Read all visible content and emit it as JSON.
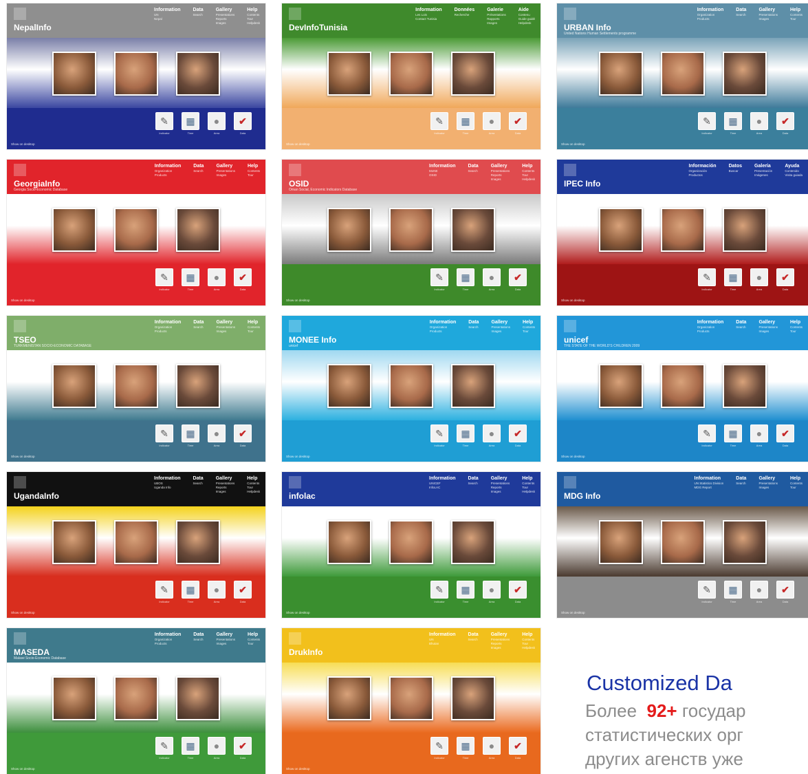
{
  "caption": {
    "title": "Customized Da",
    "line1_before": "Более",
    "line1_highlight": "92+",
    "line1_after": "государ",
    "line2": "статистических орг",
    "line3": "других агенств уже"
  },
  "footer_icon_labels": [
    "Indicator",
    "Time",
    "Area",
    "Data"
  ],
  "show_on_desktop": "Show on desktop",
  "tiles": [
    {
      "id": "nepal",
      "title": "NepalInfo",
      "subtitle": "",
      "header_color": "#8f8f8f",
      "band_top": "#7a7fa8",
      "band_bottom": "#3a46a0",
      "foot_color": "#1f2c8f",
      "menu": [
        {
          "head": "Information",
          "subs": [
            "UN",
            "Nepal"
          ]
        },
        {
          "head": "Data",
          "subs": [
            "Search"
          ]
        },
        {
          "head": "Gallery",
          "subs": [
            "Presentations",
            "Reports",
            "Images"
          ]
        },
        {
          "head": "Help",
          "subs": [
            "Contents",
            "Tour",
            "Helpdesk"
          ]
        }
      ]
    },
    {
      "id": "tunisia",
      "title": "DevInfoTunisia",
      "subtitle": "",
      "header_color": "#3f8a2c",
      "band_top": "#4a9a35",
      "band_bottom": "#f0a85a",
      "foot_color": "#f2b070",
      "menu": [
        {
          "head": "Information",
          "subs": [
            "Les Lois",
            "Contact Tunisia"
          ]
        },
        {
          "head": "Données",
          "subs": [
            "Recherche"
          ]
        },
        {
          "head": "Galerie",
          "subs": [
            "Présentations",
            "Rapports",
            "Images"
          ]
        },
        {
          "head": "Aide",
          "subs": [
            "Contenu",
            "Guide guidé",
            "Helpdesk"
          ]
        }
      ]
    },
    {
      "id": "urban",
      "title": "URBAN Info",
      "subtitle": "United Nations Human Settlements programme",
      "header_color": "#5e8fa8",
      "band_top": "#7aa3b8",
      "band_bottom": "#3e7a9a",
      "foot_color": "#3b7f9c",
      "menu": [
        {
          "head": "Information",
          "subs": [
            "Organization",
            "Products"
          ]
        },
        {
          "head": "Data",
          "subs": [
            "Search"
          ]
        },
        {
          "head": "Gallery",
          "subs": [
            "Presentations",
            "Images"
          ]
        },
        {
          "head": "Help",
          "subs": [
            "Contents",
            "Tour"
          ]
        }
      ]
    },
    {
      "id": "georgia",
      "title": "GeorgiaInfo",
      "subtitle": "Georgia Socio-Economic Database",
      "header_color": "#e1242b",
      "band_top": "#ffffff",
      "band_bottom": "#e1242b",
      "foot_color": "#e1242b",
      "menu": [
        {
          "head": "Information",
          "subs": [
            "Organization",
            "Products"
          ]
        },
        {
          "head": "Data",
          "subs": [
            "Search"
          ]
        },
        {
          "head": "Gallery",
          "subs": [
            "Presentations",
            "Images"
          ]
        },
        {
          "head": "Help",
          "subs": [
            "Contents",
            "Tour"
          ]
        }
      ]
    },
    {
      "id": "osid",
      "title": "OSID",
      "subtitle": "Oman Social, Economic Indicators Database",
      "header_color": "#e04b4e",
      "band_top": "#c9c9c9",
      "band_bottom": "#7a7a7a",
      "foot_color": "#3e8a2a",
      "menu": [
        {
          "head": "Information",
          "subs": [
            "MoNE",
            "OSID"
          ]
        },
        {
          "head": "Data",
          "subs": [
            "Search"
          ]
        },
        {
          "head": "Gallery",
          "subs": [
            "Presentations",
            "Reports",
            "Images"
          ]
        },
        {
          "head": "Help",
          "subs": [
            "Contents",
            "Tour",
            "Helpdesk"
          ]
        }
      ]
    },
    {
      "id": "ipec",
      "title": "IPEC Info",
      "subtitle": "",
      "header_color": "#1f3a9a",
      "band_top": "#ffffff",
      "band_bottom": "#b01c1c",
      "foot_color": "#9e1414",
      "menu": [
        {
          "head": "Información",
          "subs": [
            "Organización",
            "Productos"
          ]
        },
        {
          "head": "Datos",
          "subs": [
            "Buscar"
          ]
        },
        {
          "head": "Galería",
          "subs": [
            "Presentación",
            "Imágenes"
          ]
        },
        {
          "head": "Ayuda",
          "subs": [
            "Contenido",
            "Visita guiada"
          ]
        }
      ]
    },
    {
      "id": "tseo",
      "title": "TSEO",
      "subtitle": "TURKMENISTAN SOCIO-ECONOMIC DATABASE",
      "header_color": "#7fae6a",
      "band_top": "#ffffff",
      "band_bottom": "#3f7a8f",
      "foot_color": "#3f728c",
      "menu": [
        {
          "head": "Information",
          "subs": [
            "Organization",
            "Products"
          ]
        },
        {
          "head": "Data",
          "subs": [
            "Search"
          ]
        },
        {
          "head": "Gallery",
          "subs": [
            "Presentations",
            "Images"
          ]
        },
        {
          "head": "Help",
          "subs": [
            "Contents",
            "Tour"
          ]
        }
      ]
    },
    {
      "id": "monee",
      "title": "MONEE Info",
      "subtitle": "unicef",
      "header_color": "#1fa8dc",
      "band_top": "#9fd8f0",
      "band_bottom": "#2cb0e0",
      "foot_color": "#1f9ed4",
      "menu": [
        {
          "head": "Information",
          "subs": [
            "Organization",
            "Products"
          ]
        },
        {
          "head": "Data",
          "subs": [
            "Search"
          ]
        },
        {
          "head": "Gallery",
          "subs": [
            "Presentations",
            "Images"
          ]
        },
        {
          "head": "Help",
          "subs": [
            "Contents",
            "Tour"
          ]
        }
      ]
    },
    {
      "id": "unicef",
      "title": "unicef",
      "subtitle": "THE STATE OF THE WORLD'S CHILDREN 2009",
      "header_color": "#2296d8",
      "band_top": "#ffffff",
      "band_bottom": "#1f8fd0",
      "foot_color": "#1d86c8",
      "menu": [
        {
          "head": "Information",
          "subs": [
            "Organization",
            "Products"
          ]
        },
        {
          "head": "Data",
          "subs": [
            "Search"
          ]
        },
        {
          "head": "Gallery",
          "subs": [
            "Presentations",
            "Images"
          ]
        },
        {
          "head": "Help",
          "subs": [
            "Contents",
            "Tour"
          ]
        }
      ]
    },
    {
      "id": "uganda",
      "title": "UgandaInfo",
      "subtitle": "",
      "header_color": "#111111",
      "band_top": "#f4d21c",
      "band_bottom": "#d72c1c",
      "foot_color": "#d92e1e",
      "menu": [
        {
          "head": "Information",
          "subs": [
            "UBOS",
            "Uganda Info"
          ]
        },
        {
          "head": "Data",
          "subs": [
            "Search"
          ]
        },
        {
          "head": "Gallery",
          "subs": [
            "Presentations",
            "Reports",
            "Images"
          ]
        },
        {
          "head": "Help",
          "subs": [
            "Contents",
            "Tour",
            "Helpdesk"
          ]
        }
      ]
    },
    {
      "id": "infolac",
      "title": "infolac",
      "subtitle": "",
      "header_color": "#1f3a9a",
      "band_top": "#ffffff",
      "band_bottom": "#3e9a3a",
      "foot_color": "#3a8f2f",
      "menu": [
        {
          "head": "Information",
          "subs": [
            "UNICEF",
            "InfoLAC"
          ]
        },
        {
          "head": "Data",
          "subs": [
            "Search"
          ]
        },
        {
          "head": "Gallery",
          "subs": [
            "Presentations",
            "Reports",
            "Images"
          ]
        },
        {
          "head": "Help",
          "subs": [
            "Contents",
            "Tour",
            "Helpdesk"
          ]
        }
      ]
    },
    {
      "id": "mdg",
      "title": "MDG Info",
      "subtitle": "",
      "header_color": "#1f5aa0",
      "band_top": "#6b5a4a",
      "band_bottom": "#4a3a2f",
      "foot_color": "#8c8c8c",
      "menu": [
        {
          "head": "Information",
          "subs": [
            "UN Statistics Division",
            "MDG Report"
          ]
        },
        {
          "head": "Data",
          "subs": [
            "Search"
          ]
        },
        {
          "head": "Gallery",
          "subs": [
            "Presentations",
            "Images"
          ]
        },
        {
          "head": "Help",
          "subs": [
            "Contents",
            "Tour"
          ]
        }
      ]
    },
    {
      "id": "malawi",
      "title": "MASEDA",
      "subtitle": "Malawi Socio-Economic Database",
      "header_color": "#3f7a8c",
      "band_top": "#ffffff",
      "band_bottom": "#3d8f3d",
      "foot_color": "#3f9a3a",
      "menu": [
        {
          "head": "Information",
          "subs": [
            "Organization",
            "Products"
          ]
        },
        {
          "head": "Data",
          "subs": [
            "Search"
          ]
        },
        {
          "head": "Gallery",
          "subs": [
            "Presentations",
            "Images"
          ]
        },
        {
          "head": "Help",
          "subs": [
            "Contents",
            "Tour"
          ]
        }
      ]
    },
    {
      "id": "druk",
      "title": "DrukInfo",
      "subtitle": "",
      "header_color": "#f2c01c",
      "band_top": "#f7dd55",
      "band_bottom": "#ea6a1f",
      "foot_color": "#e8691e",
      "menu": [
        {
          "head": "Information",
          "subs": [
            "UN",
            "Bhutan"
          ]
        },
        {
          "head": "Data",
          "subs": [
            "Search"
          ]
        },
        {
          "head": "Gallery",
          "subs": [
            "Presentations",
            "Reports",
            "Images"
          ]
        },
        {
          "head": "Help",
          "subs": [
            "Contents",
            "Tour",
            "Helpdesk"
          ]
        }
      ]
    }
  ]
}
